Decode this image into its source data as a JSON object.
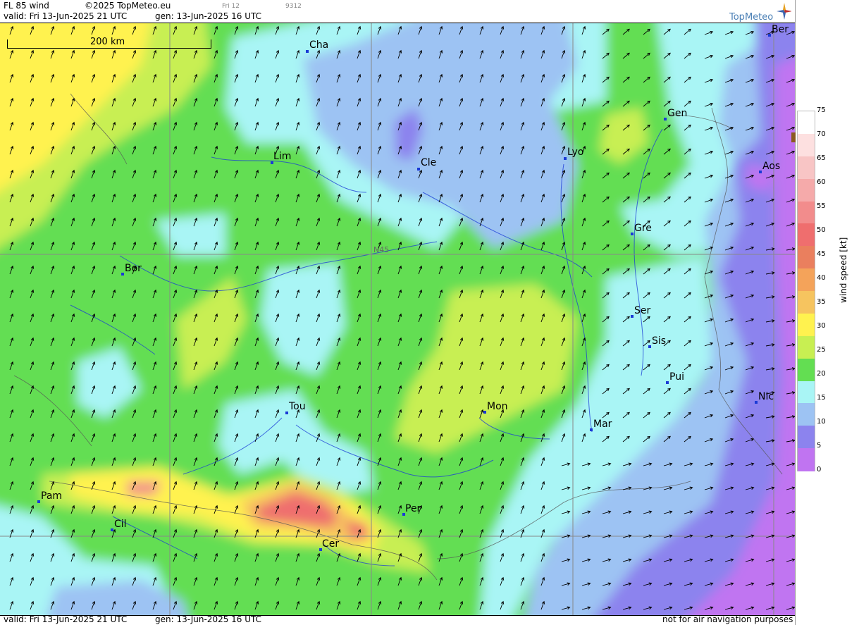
{
  "header": {
    "product": "FL 85 wind",
    "copyright": "©2025 TopMeteo.eu",
    "small_day": "Fri 12",
    "small_code": "9312",
    "valid": "valid:  Fri  13-Jun-2025  21 UTC",
    "gen": "gen: 13-Jun-2025 16 UTC"
  },
  "logo": {
    "text": "TopMeteo"
  },
  "footer": {
    "valid": "valid:  Fri  13-Jun-2025  21 UTC",
    "gen": "gen: 13-Jun-2025 16 UTC",
    "disclaimer": "not for air navigation purposes"
  },
  "scale": {
    "label": "200 km"
  },
  "grid": {
    "label": "N45"
  },
  "legend": {
    "title": "wind speed [kt]",
    "ticks": [
      "75",
      "70",
      "65",
      "60",
      "55",
      "50",
      "45",
      "40",
      "35",
      "30",
      "25",
      "20",
      "15",
      "10",
      "5",
      "0"
    ],
    "colors": [
      "#ffffff",
      "#fde0e0",
      "#f8c5c5",
      "#f5aaaa",
      "#f28c8c",
      "#ef6e6e",
      "#ea7f5e",
      "#f4a35a",
      "#f6c45f",
      "#fff24f",
      "#c8ef52",
      "#63de52",
      "#a9f5f5",
      "#9dc3f3",
      "#8c83ee",
      "#c074f1"
    ]
  },
  "cities": [
    {
      "name": "Cha"
    },
    {
      "name": "Lim"
    },
    {
      "name": "Cle"
    },
    {
      "name": "Lyo"
    },
    {
      "name": "Gen"
    },
    {
      "name": "Ber"
    },
    {
      "name": "Aos"
    },
    {
      "name": "Gre"
    },
    {
      "name": "Bor"
    },
    {
      "name": "Ser"
    },
    {
      "name": "Sis"
    },
    {
      "name": "Pui"
    },
    {
      "name": "Nic"
    },
    {
      "name": "Tou"
    },
    {
      "name": "Mon"
    },
    {
      "name": "Mar"
    },
    {
      "name": "Pam"
    },
    {
      "name": "Cil"
    },
    {
      "name": "Per"
    },
    {
      "name": "Cer"
    }
  ]
}
